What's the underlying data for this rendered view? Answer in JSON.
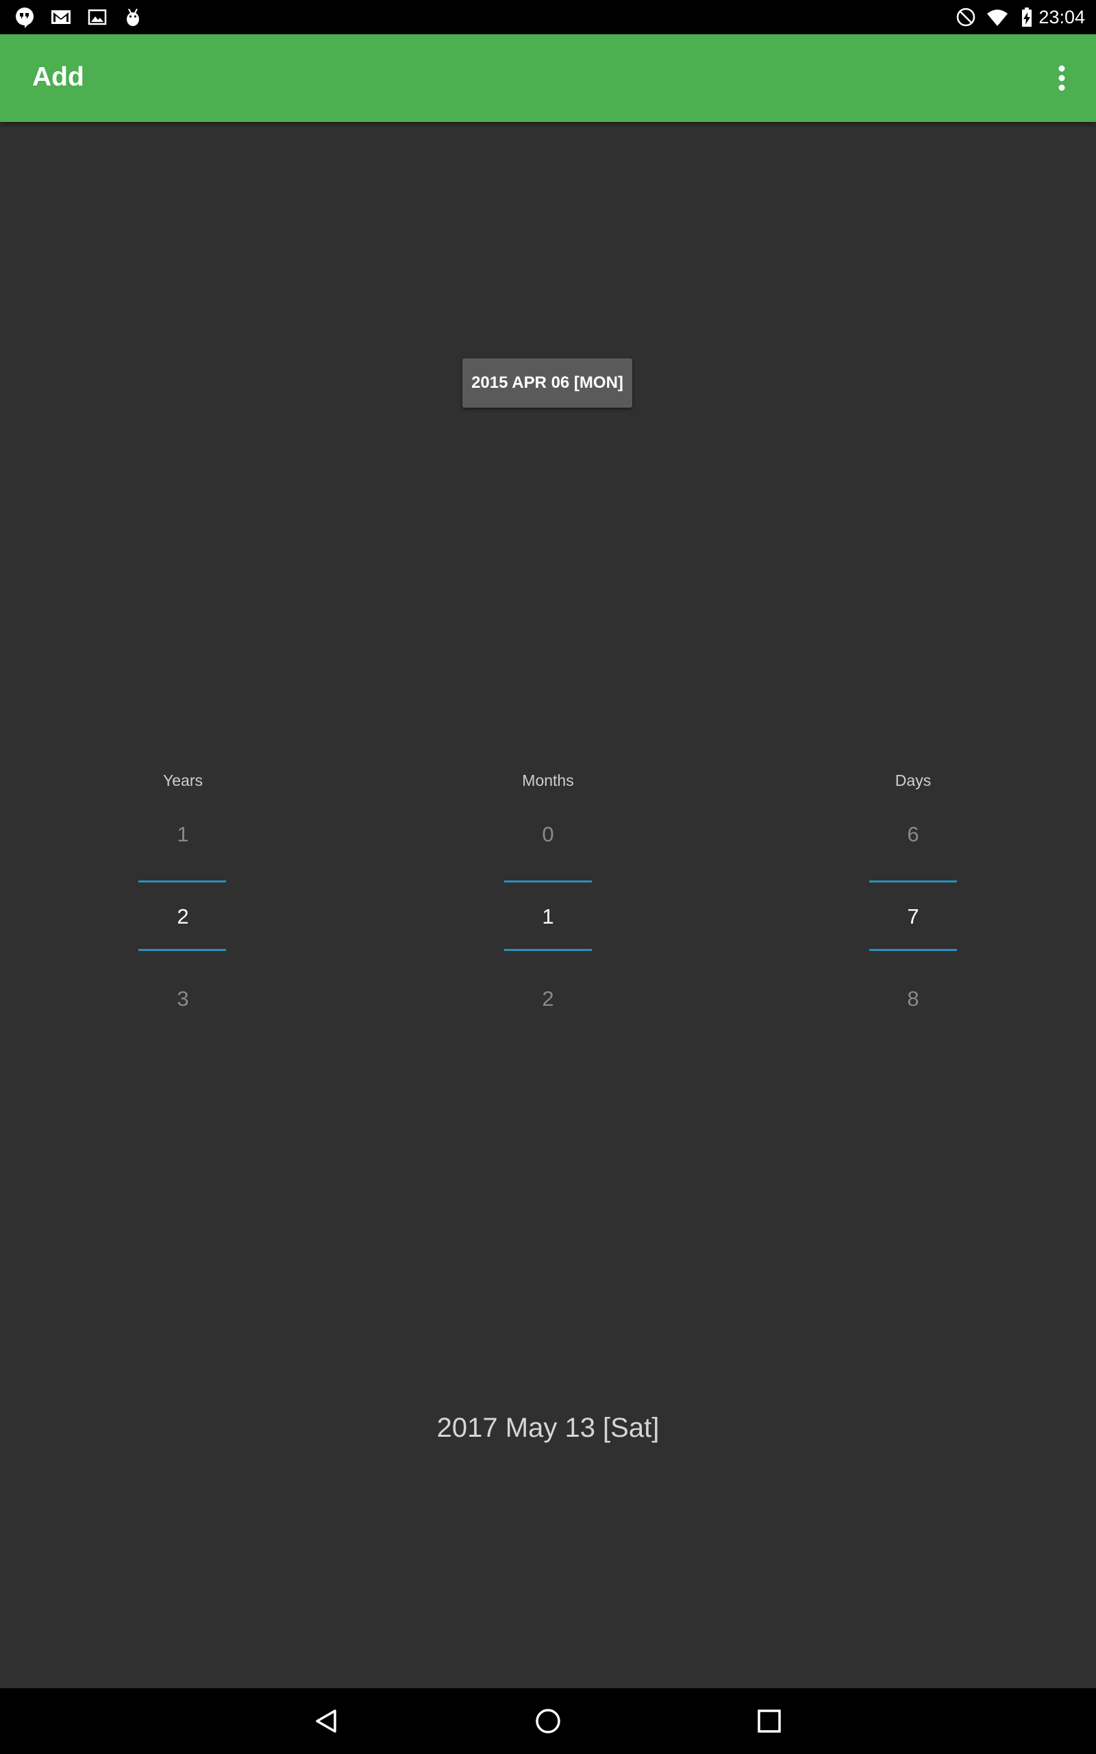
{
  "status_bar": {
    "time": "23:04",
    "left_icons": [
      "hangouts-icon",
      "gmail-icon",
      "image-icon",
      "android-debug-icon"
    ],
    "right_icons": [
      "do-not-disturb-icon",
      "wifi-icon",
      "battery-charging-icon"
    ]
  },
  "app_bar": {
    "title": "Add",
    "background": "#4caf50",
    "menu_icon": "overflow-menu-icon"
  },
  "date_button": {
    "label": "2015 APR 06 [MON]"
  },
  "pickers": [
    {
      "label": "Years",
      "prev": "1",
      "value": "2",
      "next": "3"
    },
    {
      "label": "Months",
      "prev": "0",
      "value": "1",
      "next": "2"
    },
    {
      "label": "Days",
      "prev": "6",
      "value": "7",
      "next": "8"
    }
  ],
  "result_date": "2017 May 13 [Sat]",
  "accent_color": "#2a8fbf",
  "nav_bar": {
    "icons": [
      "back-icon",
      "home-icon",
      "recents-icon"
    ]
  }
}
